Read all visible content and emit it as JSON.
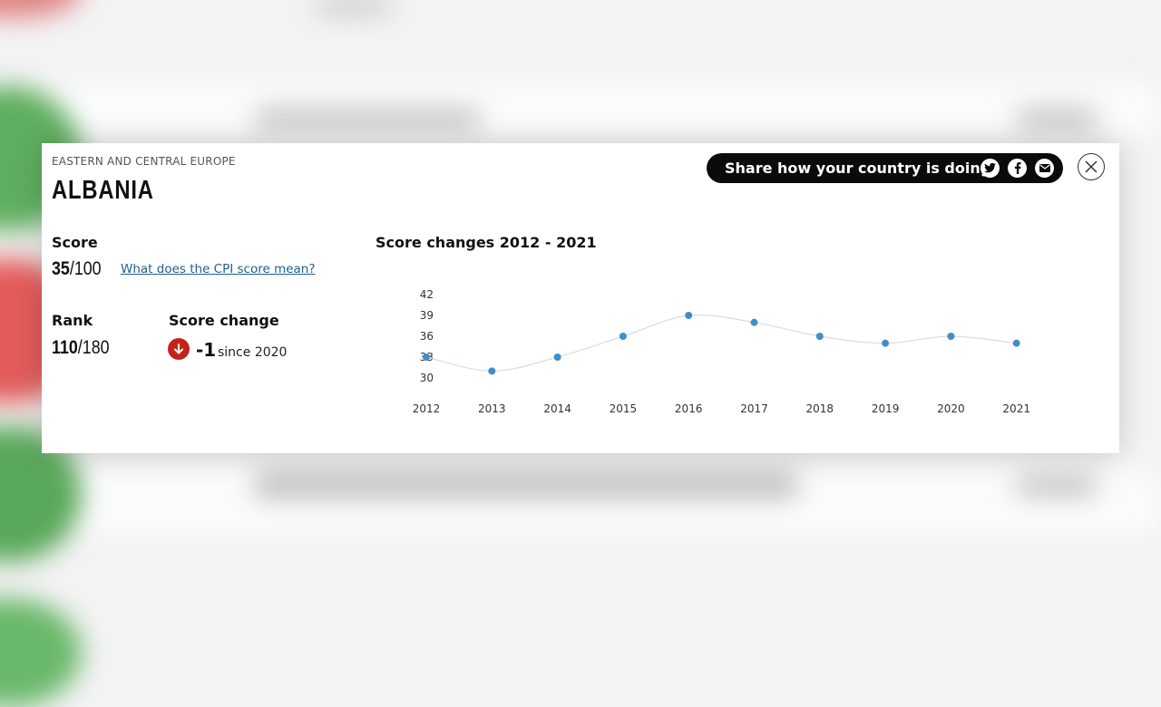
{
  "panel": {
    "region": "EASTERN AND CENTRAL EUROPE",
    "country": "ALBANIA",
    "score_label": "Score",
    "score_value": "35",
    "score_max": "/100",
    "cpi_link": "What does the CPI score mean?",
    "rank_label": "Rank",
    "rank_value": "110",
    "rank_max": "/180",
    "change_label": "Score change",
    "change_value": "-1",
    "change_since": "since 2020",
    "change_icon": "arrow-down-icon",
    "share_label": "Share how your country is doing",
    "share_icons": [
      "twitter-icon",
      "facebook-icon",
      "email-icon"
    ],
    "close_icon": "close-icon"
  },
  "chart_data": {
    "type": "line",
    "title": "Score changes 2012 - 2021",
    "x": [
      "2012",
      "2013",
      "2014",
      "2015",
      "2016",
      "2017",
      "2018",
      "2019",
      "2020",
      "2021"
    ],
    "series": [
      {
        "values": [
          33,
          31,
          33,
          36,
          39,
          38,
          36,
          35,
          36,
          35
        ]
      }
    ],
    "yticks": [
      30,
      33,
      36,
      39,
      42
    ],
    "ylim": [
      30,
      42
    ],
    "grid": false,
    "point_color": "#3f8fc7",
    "line_color": "#d6dde3"
  }
}
